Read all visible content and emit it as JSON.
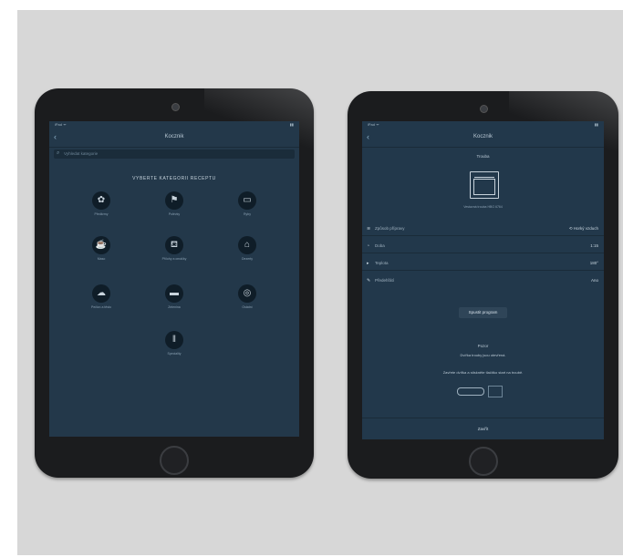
{
  "left_screen": {
    "status_left": "iPad ᯤ",
    "status_right": "▮▮",
    "title": "Kocznik",
    "back": "‹",
    "search_placeholder": "Vyhledat kategorie",
    "heading": "VYBERTE KATEGORII RECEPTU",
    "categories": [
      {
        "icon": "mixer-icon",
        "glyph": "✿",
        "label": "Předkrmy"
      },
      {
        "icon": "flag-icon",
        "glyph": "⚑",
        "label": "Polévky"
      },
      {
        "icon": "pan-icon",
        "glyph": "▭",
        "label": "Ryby"
      },
      {
        "icon": "cup-icon",
        "glyph": "☕",
        "label": "Maso"
      },
      {
        "icon": "bottle-icon",
        "glyph": "⛾",
        "label": "Přílohy a omáčky"
      },
      {
        "icon": "cake-icon",
        "glyph": "⌂",
        "label": "Dezerty"
      },
      {
        "icon": "bread-icon",
        "glyph": "☁",
        "label": "Pečivo a těsto"
      },
      {
        "icon": "pot-icon",
        "glyph": "▬",
        "label": "Zelenina"
      },
      {
        "icon": "bowl-icon",
        "glyph": "◎",
        "label": "Ostatní"
      },
      {
        "icon": "cutlery-icon",
        "glyph": "ǁ",
        "label": "Speciality"
      }
    ]
  },
  "right_screen": {
    "status_left": "iPad ᯤ",
    "status_right": "▮▮",
    "title": "Kocznik",
    "back": "‹",
    "oven_caption": "Trouba",
    "oven_model": "Vestavná trouba HBG 6764",
    "rows": [
      {
        "icon": "steam-icon",
        "glyph": "≋",
        "label": "Způsob přípravy",
        "value": "⟲ Horký vzduch"
      },
      {
        "icon": "timer-icon",
        "glyph": "◔",
        "label": "Doba",
        "value": "1:15"
      },
      {
        "icon": "thermometer-icon",
        "glyph": "▸",
        "label": "Teplota",
        "value": "180°"
      },
      {
        "icon": "pencil-icon",
        "glyph": "✎",
        "label": "Předehřátí",
        "value": "Ano"
      }
    ],
    "start_button": "Spustit program",
    "note_title": "Pozor",
    "note_line1": "Dvířka trouby jsou otevřená.",
    "note_line2": "Zavřete dvířka a stiskněte tlačítko start na troubě.",
    "bottom_label": "Zavřít"
  }
}
